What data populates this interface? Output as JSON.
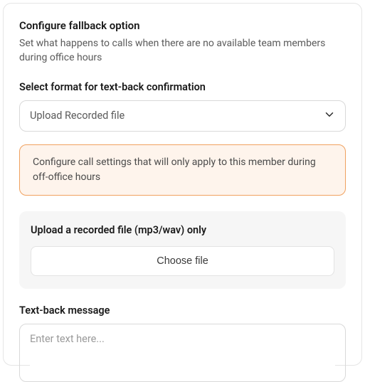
{
  "header": {
    "title": "Configure fallback option",
    "subtitle": "Set what happens to calls when there are no available team members during office hours"
  },
  "format": {
    "label": "Select format for text-back confirmation",
    "selected": "Upload Recorded file"
  },
  "info_banner": {
    "text": "Configure call settings that will only apply to this member during off-office hours"
  },
  "upload": {
    "title": "Upload a recorded file (mp3/wav) only",
    "button": "Choose file"
  },
  "textback": {
    "label": "Text-back message",
    "placeholder": "Enter text here..."
  }
}
